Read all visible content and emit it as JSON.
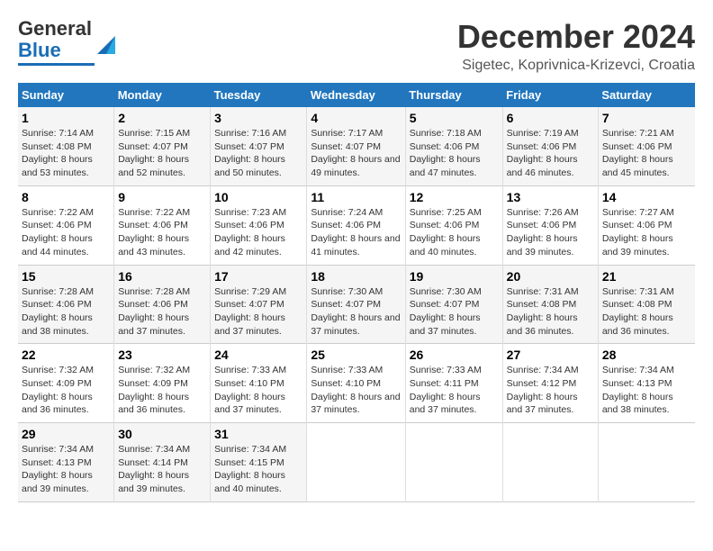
{
  "logo": {
    "line1": "General",
    "line2": "Blue"
  },
  "title": "December 2024",
  "location": "Sigetec, Koprivnica-Krizevci, Croatia",
  "days_of_week": [
    "Sunday",
    "Monday",
    "Tuesday",
    "Wednesday",
    "Thursday",
    "Friday",
    "Saturday"
  ],
  "weeks": [
    [
      {
        "day": "1",
        "sunrise": "7:14 AM",
        "sunset": "4:08 PM",
        "daylight": "8 hours and 53 minutes."
      },
      {
        "day": "2",
        "sunrise": "7:15 AM",
        "sunset": "4:07 PM",
        "daylight": "8 hours and 52 minutes."
      },
      {
        "day": "3",
        "sunrise": "7:16 AM",
        "sunset": "4:07 PM",
        "daylight": "8 hours and 50 minutes."
      },
      {
        "day": "4",
        "sunrise": "7:17 AM",
        "sunset": "4:07 PM",
        "daylight": "8 hours and 49 minutes."
      },
      {
        "day": "5",
        "sunrise": "7:18 AM",
        "sunset": "4:06 PM",
        "daylight": "8 hours and 47 minutes."
      },
      {
        "day": "6",
        "sunrise": "7:19 AM",
        "sunset": "4:06 PM",
        "daylight": "8 hours and 46 minutes."
      },
      {
        "day": "7",
        "sunrise": "7:21 AM",
        "sunset": "4:06 PM",
        "daylight": "8 hours and 45 minutes."
      }
    ],
    [
      {
        "day": "8",
        "sunrise": "7:22 AM",
        "sunset": "4:06 PM",
        "daylight": "8 hours and 44 minutes."
      },
      {
        "day": "9",
        "sunrise": "7:22 AM",
        "sunset": "4:06 PM",
        "daylight": "8 hours and 43 minutes."
      },
      {
        "day": "10",
        "sunrise": "7:23 AM",
        "sunset": "4:06 PM",
        "daylight": "8 hours and 42 minutes."
      },
      {
        "day": "11",
        "sunrise": "7:24 AM",
        "sunset": "4:06 PM",
        "daylight": "8 hours and 41 minutes."
      },
      {
        "day": "12",
        "sunrise": "7:25 AM",
        "sunset": "4:06 PM",
        "daylight": "8 hours and 40 minutes."
      },
      {
        "day": "13",
        "sunrise": "7:26 AM",
        "sunset": "4:06 PM",
        "daylight": "8 hours and 39 minutes."
      },
      {
        "day": "14",
        "sunrise": "7:27 AM",
        "sunset": "4:06 PM",
        "daylight": "8 hours and 39 minutes."
      }
    ],
    [
      {
        "day": "15",
        "sunrise": "7:28 AM",
        "sunset": "4:06 PM",
        "daylight": "8 hours and 38 minutes."
      },
      {
        "day": "16",
        "sunrise": "7:28 AM",
        "sunset": "4:06 PM",
        "daylight": "8 hours and 37 minutes."
      },
      {
        "day": "17",
        "sunrise": "7:29 AM",
        "sunset": "4:07 PM",
        "daylight": "8 hours and 37 minutes."
      },
      {
        "day": "18",
        "sunrise": "7:30 AM",
        "sunset": "4:07 PM",
        "daylight": "8 hours and 37 minutes."
      },
      {
        "day": "19",
        "sunrise": "7:30 AM",
        "sunset": "4:07 PM",
        "daylight": "8 hours and 37 minutes."
      },
      {
        "day": "20",
        "sunrise": "7:31 AM",
        "sunset": "4:08 PM",
        "daylight": "8 hours and 36 minutes."
      },
      {
        "day": "21",
        "sunrise": "7:31 AM",
        "sunset": "4:08 PM",
        "daylight": "8 hours and 36 minutes."
      }
    ],
    [
      {
        "day": "22",
        "sunrise": "7:32 AM",
        "sunset": "4:09 PM",
        "daylight": "8 hours and 36 minutes."
      },
      {
        "day": "23",
        "sunrise": "7:32 AM",
        "sunset": "4:09 PM",
        "daylight": "8 hours and 36 minutes."
      },
      {
        "day": "24",
        "sunrise": "7:33 AM",
        "sunset": "4:10 PM",
        "daylight": "8 hours and 37 minutes."
      },
      {
        "day": "25",
        "sunrise": "7:33 AM",
        "sunset": "4:10 PM",
        "daylight": "8 hours and 37 minutes."
      },
      {
        "day": "26",
        "sunrise": "7:33 AM",
        "sunset": "4:11 PM",
        "daylight": "8 hours and 37 minutes."
      },
      {
        "day": "27",
        "sunrise": "7:34 AM",
        "sunset": "4:12 PM",
        "daylight": "8 hours and 37 minutes."
      },
      {
        "day": "28",
        "sunrise": "7:34 AM",
        "sunset": "4:13 PM",
        "daylight": "8 hours and 38 minutes."
      }
    ],
    [
      {
        "day": "29",
        "sunrise": "7:34 AM",
        "sunset": "4:13 PM",
        "daylight": "8 hours and 39 minutes."
      },
      {
        "day": "30",
        "sunrise": "7:34 AM",
        "sunset": "4:14 PM",
        "daylight": "8 hours and 39 minutes."
      },
      {
        "day": "31",
        "sunrise": "7:34 AM",
        "sunset": "4:15 PM",
        "daylight": "8 hours and 40 minutes."
      },
      null,
      null,
      null,
      null
    ]
  ]
}
